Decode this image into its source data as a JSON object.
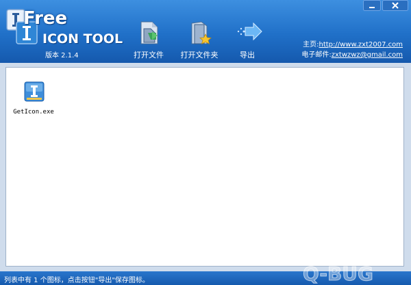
{
  "app": {
    "title_free": "Free",
    "title_tool": "ICON TOOL",
    "version": "版本 2.1.4"
  },
  "toolbar": {
    "open_file": "打开文件",
    "open_folder": "打开文件夹",
    "export": "导出"
  },
  "links": {
    "homepage_label": "主页:",
    "homepage_url": "http://www.zxt2007.com",
    "email_label": "电子邮件:",
    "email_value": "zxtwzwz@gmail.com"
  },
  "files": [
    {
      "name": "GetIcon.exe",
      "icon": "app-icon"
    }
  ],
  "status": {
    "text": "列表中有 1 个图标，点击按钮\"导出\"保存图标。"
  },
  "watermark": {
    "text": "Q-BUG"
  },
  "colors": {
    "header_top": "#3d8fe0",
    "header_bottom": "#1559ad",
    "content_bg": "#ffffff",
    "frame_bg": "#cfdcec"
  }
}
